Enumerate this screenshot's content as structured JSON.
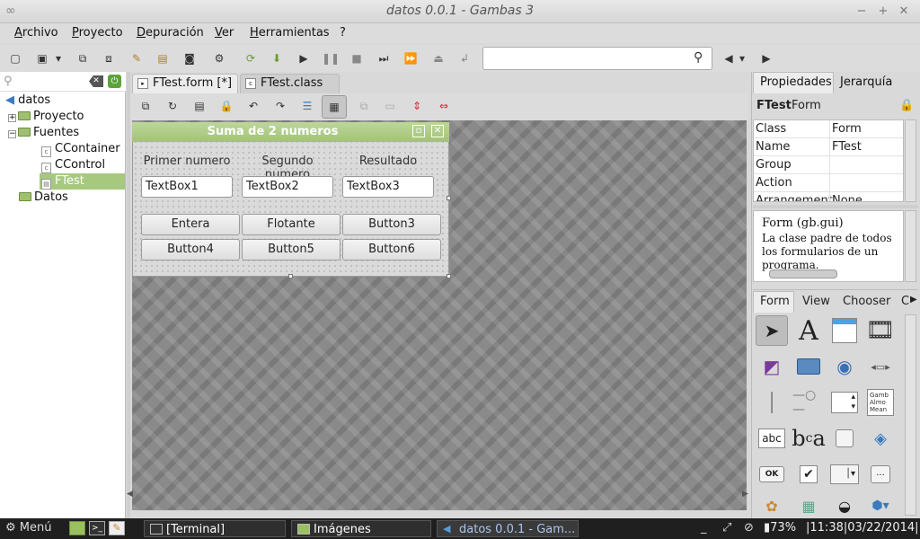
{
  "window": {
    "title": "datos 0.0.1 - Gambas 3",
    "min_icon": "minimize-icon",
    "max_icon": "maximize-icon",
    "close_icon": "close-icon"
  },
  "menu": [
    "Archivo",
    "Proyecto",
    "Depuración",
    "Ver",
    "Herramientas",
    "?"
  ],
  "project_tree": {
    "root": "datos",
    "items": [
      {
        "label": "Proyecto"
      },
      {
        "label": "Fuentes"
      },
      {
        "label": "CContainer"
      },
      {
        "label": "CControl"
      },
      {
        "label": "FTest",
        "selected": true
      },
      {
        "label": "Datos"
      }
    ]
  },
  "tabs": [
    {
      "label": "FTest.form [*]",
      "active": true
    },
    {
      "label": "FTest.class [*]",
      "active": false
    }
  ],
  "form": {
    "title": "Suma de 2 numeros",
    "labels": [
      "Primer numero",
      "Segundo numero",
      "Resultado"
    ],
    "textboxes": [
      "TextBox1",
      "TextBox2",
      "TextBox3"
    ],
    "buttons": [
      "Entera",
      "Flotante",
      "Button3",
      "Button4",
      "Button5",
      "Button6"
    ]
  },
  "properties": {
    "tabs": [
      "Propiedades",
      "Jerarquía"
    ],
    "object_name": "FTest",
    "object_class": "Form",
    "rows": [
      {
        "key": "Class",
        "value": "Form"
      },
      {
        "key": "Name",
        "value": "FTest"
      },
      {
        "key": "Group",
        "value": ""
      },
      {
        "key": "Action",
        "value": ""
      },
      {
        "key": "Arrangement",
        "value": "None"
      }
    ],
    "desc_title": "Form (gb.gui)",
    "desc_text": "La clase padre de todos los formularios de un programa."
  },
  "toolbox": {
    "tabs": [
      "Form",
      "View",
      "Chooser",
      "C"
    ]
  },
  "taskbar": {
    "menu_label": "Menú",
    "tasks": [
      "[Terminal]",
      "Imágenes",
      "datos 0.0.1 - Gam..."
    ],
    "battery": "73%",
    "clock": "11:38|03/22/2014"
  },
  "colors": {
    "form_header": "#a3c27a",
    "selection": "#a7c97f",
    "taskbar": "#1f1f1f"
  }
}
